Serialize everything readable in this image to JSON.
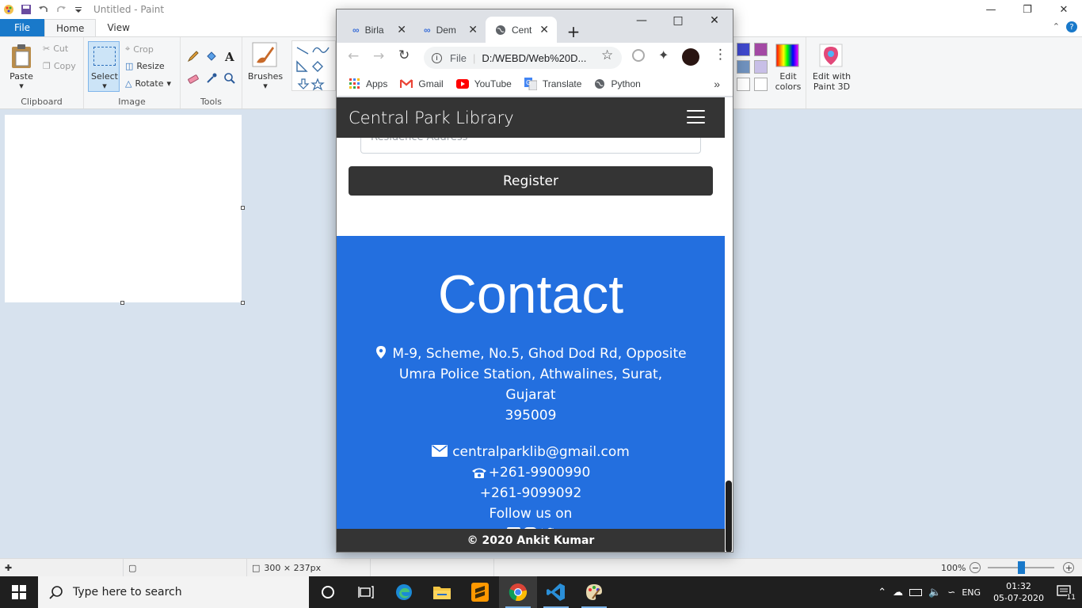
{
  "paint": {
    "title": "Untitled - Paint",
    "tabs": [
      "File",
      "Home",
      "View"
    ],
    "clipboard": {
      "paste": "Paste",
      "cut": "Cut",
      "copy": "Copy",
      "label": "Clipboard"
    },
    "image": {
      "select": "Select",
      "crop": "Crop",
      "resize": "Resize",
      "rotate": "Rotate",
      "label": "Image"
    },
    "tools": {
      "label": "Tools"
    },
    "brushes": "Brushes",
    "edit_colors": "Edit colors",
    "edit_paint3d": "Edit with Paint 3D",
    "status": {
      "size": "300 × 237px",
      "zoom": "100%"
    },
    "swatches": [
      "#3f48cc",
      "#a349a4",
      "#7092be",
      "#c8bfe7",
      "#ffffff",
      "#ffffff"
    ]
  },
  "chrome": {
    "tabs": [
      {
        "title": "Birla",
        "icon": "link-icon"
      },
      {
        "title": "Dem",
        "icon": "link-icon"
      },
      {
        "title": "Cent",
        "icon": "globe-icon",
        "active": true
      }
    ],
    "address_scheme": "File",
    "address_url": "D:/WEBD/Web%20D...",
    "bookmarks": [
      {
        "label": "Apps",
        "icon": "apps-grid-icon"
      },
      {
        "label": "Gmail",
        "icon": "gmail-icon"
      },
      {
        "label": "YouTube",
        "icon": "youtube-icon"
      },
      {
        "label": "Translate",
        "icon": "translate-icon"
      },
      {
        "label": "Python",
        "icon": "globe-icon"
      }
    ]
  },
  "page": {
    "brand": "Central Park Library",
    "address_placeholder": "Residence Address",
    "register_label": "Register",
    "contact": {
      "heading": "Contact",
      "address_lines": [
        "M-9, Scheme, No.5, Ghod Dod Rd, Opposite",
        "Umra Police Station, Athwalines, Surat, Gujarat",
        "395009"
      ],
      "email": "centralparklib@gmail.com",
      "phone1": "+261-9900990",
      "phone2": "+261-9099092",
      "follow": "Follow us on"
    },
    "footer": "© 2020 Ankit Kumar",
    "colors": {
      "navbar": "#343434",
      "contact_bg": "#236fdf"
    }
  },
  "taskbar": {
    "search_placeholder": "Type here to search",
    "lang": "ENG",
    "time": "01:32",
    "date": "05-07-2020",
    "notifications": "11"
  }
}
